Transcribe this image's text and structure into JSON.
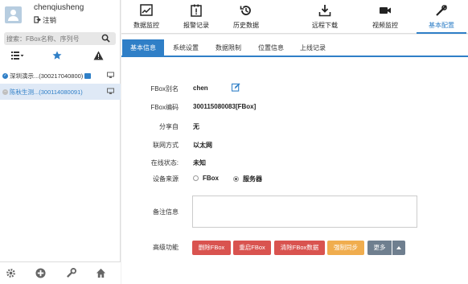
{
  "user": {
    "name": "chenqiusheng",
    "logout_label": "注销"
  },
  "search": {
    "placeholder": "搜索：FBox名称、序列号"
  },
  "devices": [
    {
      "name": "深圳演示...(300217040800)",
      "status": "online"
    },
    {
      "name": "陈秋生测...(300114080091)",
      "status": "offline"
    }
  ],
  "nav": [
    {
      "label": "数据监控",
      "icon": "monitor-icon"
    },
    {
      "label": "报警记录",
      "icon": "alarm-record-icon"
    },
    {
      "label": "历史数据",
      "icon": "history-icon"
    },
    {
      "label": "远程下载",
      "icon": "download-icon"
    },
    {
      "label": "视频监控",
      "icon": "video-icon"
    },
    {
      "label": "基本配置",
      "icon": "config-icon"
    }
  ],
  "tabs": [
    "基本信息",
    "系统设置",
    "数据限制",
    "位置信息",
    "上线记录"
  ],
  "form": {
    "alias_label": "FBox别名",
    "alias_value": "chen",
    "code_label": "FBox编码",
    "code_value": "300115080083[FBox]",
    "share_label": "分享自",
    "share_value": "无",
    "network_label": "联网方式",
    "network_value": "以太网",
    "online_label": "在线状态:",
    "online_value": "未知",
    "source_label": "设备来源",
    "source_options": [
      "FBox",
      "服务器"
    ],
    "source_selected": "服务器",
    "remark_label": "备注信息",
    "advanced_label": "高级功能"
  },
  "buttons": {
    "delete": "删除FBox",
    "restart": "重启FBox",
    "clear": "清除FBox数据",
    "sync": "强制同步",
    "more": "更多"
  },
  "colors": {
    "accent": "#2f7fc7",
    "danger": "#d9534f",
    "warning": "#f0ad4e",
    "secondary": "#6f7f8f"
  }
}
